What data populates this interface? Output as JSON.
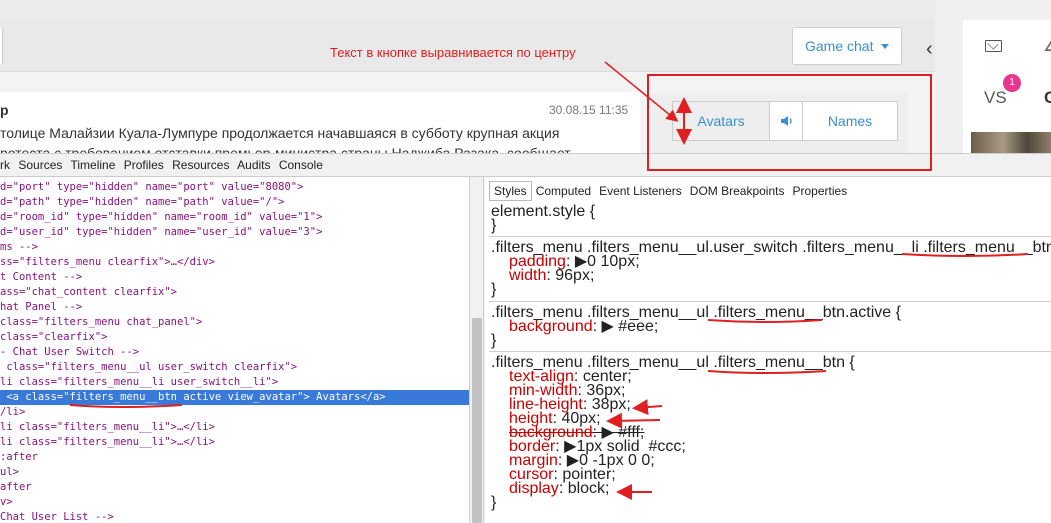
{
  "header": {
    "game_chat_label": "Game chat",
    "vs_label": "VS",
    "badge_count": "1"
  },
  "annotation": "Текст в кнопке выравнивается по центру",
  "message": {
    "author": "р",
    "time": "30.08.15 11:35",
    "text_line1": "толице Малайзии Куала-Лумпуре продолжается начавшаяся в субботу крупная акция",
    "text_line2": "ротеста с требованием отставки премьер-министра страны Наджиба Разака, сообщает"
  },
  "user_switch": {
    "avatars_label": "Avatars",
    "names_label": "Names"
  },
  "devtools": {
    "tabs": [
      "rk",
      "Sources",
      "Timeline",
      "Profiles",
      "Resources",
      "Audits",
      "Console"
    ],
    "dom_lines": [
      "d=\"port\" type=\"hidden\" name=\"port\" value=\"8080\">",
      "d=\"path\" type=\"hidden\" name=\"path\" value=\"/\">",
      "d=\"room_id\" type=\"hidden\" name=\"room_id\" value=\"1\">",
      "d=\"user_id\" type=\"hidden\" name=\"user_id\" value=\"3\">",
      "ms -->",
      "ss=\"filters_menu clearfix\">…</div>",
      "t Content -->",
      "ass=\"chat_content clearfix\">",
      "hat Panel -->",
      "class=\"filters_menu chat_panel\">",
      "class=\"clearfix\">",
      "- Chat User Switch -->",
      " class=\"filters_menu__ul user_switch clearfix\">",
      "li class=\"filters_menu__li user_switch__li\">",
      " <a class=\"filters_menu__btn active view_avatar\"> Avatars</a>",
      "/li>",
      "li class=\"filters_menu__li\">…</li>",
      "li class=\"filters_menu__li\">…</li>",
      ":after",
      "ul>",
      "after",
      "v>",
      "Chat User List -->"
    ],
    "styles_tabs": [
      "Styles",
      "Computed",
      "Event Listeners",
      "DOM Breakpoints",
      "Properties"
    ],
    "rules": [
      {
        "selector": "element.style {",
        "decls": []
      },
      {
        "selector": ".filters_menu .filters_menu__ul.user_switch .filters_menu__li .filters_menu__btn {",
        "decls": [
          [
            "padding",
            "▶0 10px;"
          ],
          [
            "width",
            "96px;"
          ]
        ]
      },
      {
        "selector": ".filters_menu .filters_menu__ul .filters_menu__btn.active {",
        "decls": [
          [
            "background",
            "▶ #eee;"
          ]
        ]
      },
      {
        "selector": ".filters_menu .filters_menu__ul .filters_menu__btn {",
        "decls": [
          [
            "text-align",
            "center;"
          ],
          [
            "min-width",
            "36px;"
          ],
          [
            "line-height",
            "38px;"
          ],
          [
            "height",
            "40px;"
          ],
          [
            "background",
            "▶ #fff;"
          ],
          [
            "border",
            "▶1px solid  #ccc;"
          ],
          [
            "margin",
            "▶0 -1px 0 0;"
          ],
          [
            "cursor",
            "pointer;"
          ],
          [
            "display",
            "block;"
          ]
        ]
      }
    ]
  },
  "colors": {
    "accent": "#3a8fd0",
    "annotation_red": "#e02020",
    "badge": "#e8368f",
    "selection": "#3879d9"
  }
}
